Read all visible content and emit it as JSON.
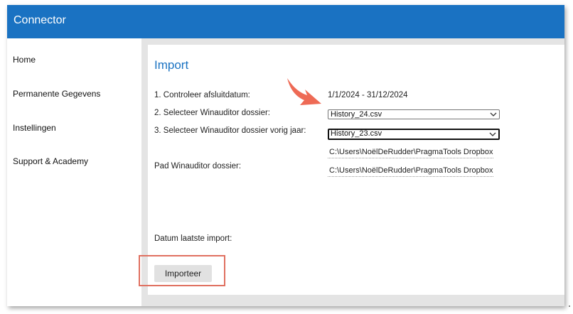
{
  "app": {
    "title": "Connector"
  },
  "sidebar": {
    "items": [
      {
        "label": "Home"
      },
      {
        "label": "Permanente Gegevens"
      },
      {
        "label": "Instellingen"
      },
      {
        "label": "Support & Academy"
      }
    ]
  },
  "import": {
    "heading": "Import",
    "step1": {
      "label": "1. Controleer afsluitdatum:",
      "value": "1/1/2024 - 31/12/2024"
    },
    "step2": {
      "label": "2. Selecteer Winauditor dossier:",
      "selected": "History_24.csv"
    },
    "step3": {
      "label": "3. Selecteer Winauditor dossier vorig jaar:",
      "selected": "History_23.csv"
    },
    "pad": {
      "label": "Pad Winauditor dossier:",
      "path1": "C:\\Users\\NoëlDeRudder\\PragmaTools Dropbox",
      "path2": "C:\\Users\\NoëlDeRudder\\PragmaTools Dropbox"
    },
    "last_import": {
      "label": "Datum laatste import:"
    },
    "button_label": "Importeer"
  },
  "colors": {
    "titlebar": "#1a72c2",
    "heading": "#1a72c2",
    "annotation": "#e07060",
    "arrow": "#ee6a55"
  }
}
